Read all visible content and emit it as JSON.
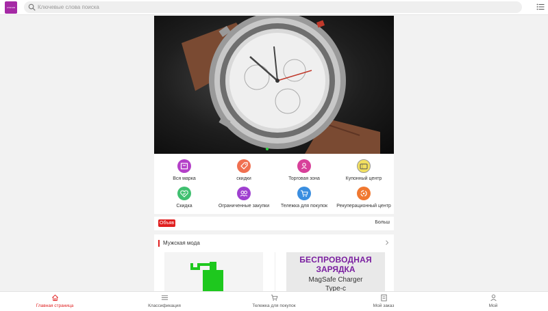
{
  "colors": {
    "accent": "#e02020",
    "brand": "#a52aa5"
  },
  "header": {
    "logo_text": "eCanada",
    "search_placeholder": "Ключевые слова поиска",
    "search_icon": "search-icon",
    "menu_icon": "list-menu-icon"
  },
  "banner": {
    "slide_indicator": "1"
  },
  "categories": [
    {
      "label": "Вся марка",
      "icon": "bag-icon",
      "color": "#b440c8"
    },
    {
      "label": "скидки",
      "icon": "tag-icon",
      "color": "#f07050"
    },
    {
      "label": "Торговая зона",
      "icon": "flower-icon",
      "color": "#d8409a"
    },
    {
      "label": "Купонный центр",
      "icon": "coupon-icon",
      "color": "#f2e060"
    },
    {
      "label": "Скидка",
      "icon": "heart-check-icon",
      "color": "#40c070"
    },
    {
      "label": "Ограниченные закупки",
      "icon": "users-icon",
      "color": "#a040d0"
    },
    {
      "label": "Тележка для покупок",
      "icon": "cart-icon",
      "color": "#3a8ee0"
    },
    {
      "label": "Рекуперационный центр",
      "icon": "recycle-icon",
      "color": "#f07830"
    }
  ],
  "notice": {
    "badge": "Объяв",
    "more": "Больш"
  },
  "section": {
    "title": "Мужская мода",
    "promo": {
      "line1": "БЕСПРОВОДНАЯ",
      "line2": "ЗАРЯДКА",
      "line3": "MagSafe Charger",
      "line4": "Type-c"
    }
  },
  "bottom_nav": [
    {
      "label": "Главная страница",
      "icon": "home-icon",
      "active": true
    },
    {
      "label": "Классификация",
      "icon": "list-icon",
      "active": false
    },
    {
      "label": "Тележка для покупок",
      "icon": "cart-icon",
      "active": false
    },
    {
      "label": "Мой заказ",
      "icon": "order-icon",
      "active": false
    },
    {
      "label": "Мой",
      "icon": "user-icon",
      "active": false
    }
  ]
}
